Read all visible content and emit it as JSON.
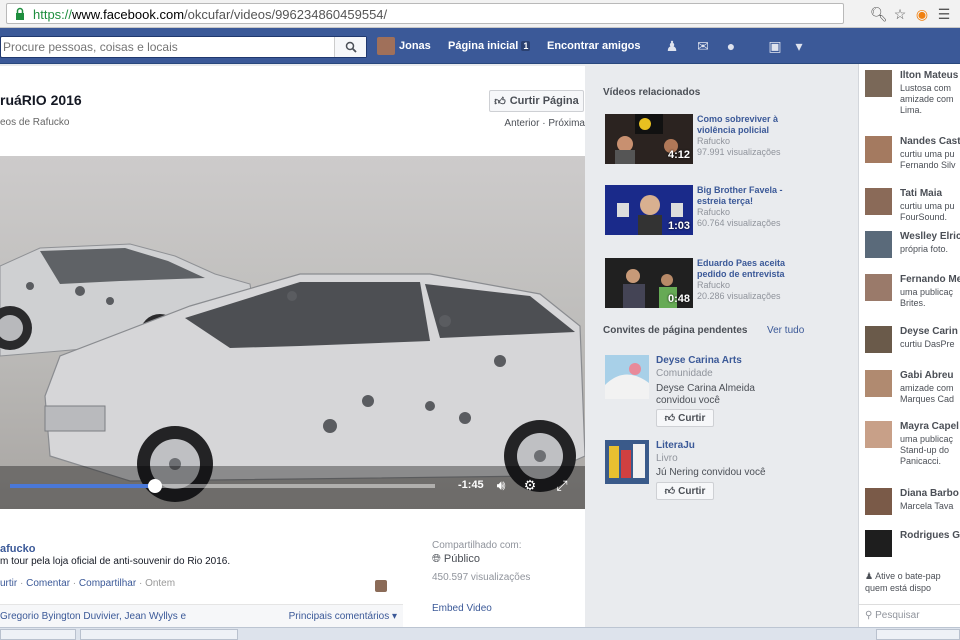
{
  "browser": {
    "url_scheme": "https://",
    "url_host": "www.facebook.com",
    "url_path": "/okcufar/videos/996234860459554/",
    "icons": [
      "zoom-icon",
      "star-icon",
      "extension-icon",
      "menu-icon"
    ]
  },
  "topbar": {
    "search_placeholder": "Procure pessoas, coisas e locais",
    "user_name": "Jonas",
    "home_label": "Página inicial",
    "home_badge": "1",
    "find_friends_label": "Encontrar amigos",
    "brand_color": "#3b5998"
  },
  "main": {
    "page_title": "ruáRIO 2016",
    "subtitle": "eos de Rafucko",
    "like_page_label": "Curtir Página",
    "nav_prev": "Anterior",
    "nav_sep": " · ",
    "nav_next": "Próxima",
    "video": {
      "time_remaining": "-1:45",
      "progress": 0.34
    },
    "owner": "afucko",
    "description": "m tour pela loja oficial de anti-souvenir do Rio 2016.",
    "actions": {
      "like": "urtir",
      "comment": "Comentar",
      "share": "Compartilhar",
      "when": "Ontem",
      "sep": " · "
    },
    "likers": "Gregorio Byington Duvivier, Jean Wyllys e",
    "top_comments": "Principais comentários ▾",
    "shared_with_label": "Compartilhado com:",
    "audience": "Público",
    "views": "450.597 visualizações",
    "embed_label": "Embed Video"
  },
  "related": {
    "section_title": "Vídeos relacionados",
    "items": [
      {
        "title": "Como sobreviver à violência policial",
        "source": "Rafucko",
        "views": "97.991 visualizações",
        "duration": "4:12"
      },
      {
        "title": "Big Brother Favela - estreia terça!",
        "source": "Rafucko",
        "views": "60.764 visualizações",
        "duration": "1:03"
      },
      {
        "title": "Eduardo Paes aceita pedido de entrevista",
        "source": "Rafucko",
        "views": "20.286 visualizações",
        "duration": "0:48"
      }
    ]
  },
  "invites": {
    "section_title": "Convites de página pendentes",
    "see_all": "Ver tudo",
    "like_label": "Curtir",
    "items": [
      {
        "name": "Deyse Carina Arts",
        "category": "Comunidade",
        "text": "Deyse Carina Almeida convidou você"
      },
      {
        "name": "LiteraJu",
        "category": "Livro",
        "text": "Jú Nering convidou você"
      }
    ]
  },
  "chat": {
    "entries": [
      {
        "name": "Ilton Mateus",
        "lines": [
          "Lustosa com",
          "amizade com",
          "Lima."
        ]
      },
      {
        "name": "Nandes Cast",
        "lines": [
          "curtiu uma pu",
          "Fernando Silv"
        ]
      },
      {
        "name": "Tati Maia",
        "lines": [
          "curtiu uma pu",
          "FourSound."
        ]
      },
      {
        "name": "Weslley Elric",
        "lines": [
          "própria foto."
        ]
      },
      {
        "name": "Fernando Me",
        "lines": [
          "uma publicaç",
          "Brites."
        ]
      },
      {
        "name": "Deyse Carin",
        "lines": [
          "curtiu DasPre"
        ]
      },
      {
        "name": "Gabi Abreu",
        "lines": [
          "amizade com",
          "Marques Cad"
        ]
      },
      {
        "name": "Mayra Capel",
        "lines": [
          "uma publicaç",
          "Stand-up do",
          "Panicacci."
        ]
      },
      {
        "name": "Diana Barbo",
        "lines": [
          "Marcela Tava"
        ]
      },
      {
        "name": "Rodrigues G",
        "lines": []
      }
    ],
    "enable_line1": "Ative o bate-pap",
    "enable_line2": "quem está dispo",
    "search_placeholder": "Pesquisar"
  }
}
